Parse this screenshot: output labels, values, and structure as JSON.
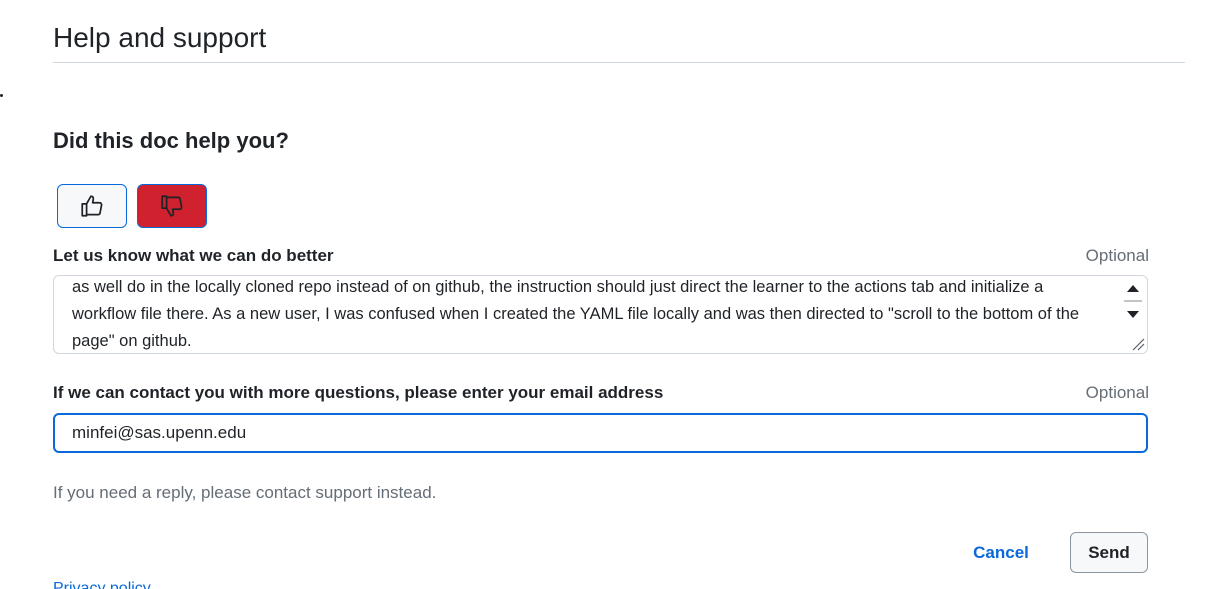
{
  "header": {
    "title": "Help and support"
  },
  "feedback": {
    "question": "Did this doc help you?",
    "thumbs_up": {
      "icon": "thumbs-up-icon",
      "selected": false
    },
    "thumbs_down": {
      "icon": "thumbs-down-icon",
      "selected": true,
      "color": "#cf222e"
    }
  },
  "improve": {
    "label": "Let us know what we can do better",
    "optional": "Optional",
    "value": "as well do in the locally cloned repo instead of on github, the instruction should just direct the learner to the actions tab and initialize a workflow file there. As a new user, I was confused when I created the YAML file locally and was then directed to \"scroll to the bottom of the page\" on github."
  },
  "contact": {
    "label": "If we can contact you with more questions, please enter your email address",
    "optional": "Optional",
    "value": "minfei@sas.upenn.edu"
  },
  "note": "If you need a reply, please contact support instead.",
  "actions": {
    "cancel": "Cancel",
    "send": "Send"
  },
  "footer": {
    "privacy": "Privacy policy"
  },
  "colors": {
    "accent": "#0969da",
    "danger": "#cf222e"
  }
}
